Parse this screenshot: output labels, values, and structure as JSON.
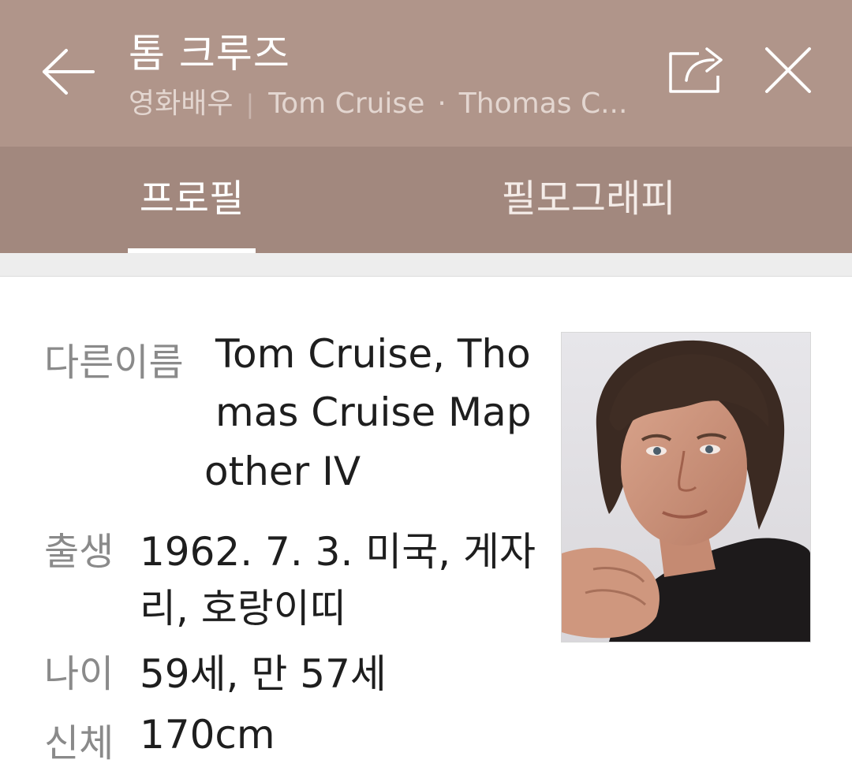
{
  "header": {
    "title": "톰 크루즈",
    "category": "영화배우",
    "separator": "|",
    "alt_name_1": "Tom Cruise",
    "dot": "·",
    "alt_name_2": "Thomas C...",
    "back_icon": "arrow-left-icon",
    "share_icon": "share-icon",
    "close_icon": "close-icon"
  },
  "tabs": [
    {
      "label": "프로필",
      "active": true
    },
    {
      "label": "필모그래피",
      "active": false
    }
  ],
  "profile": {
    "other_names": {
      "label": "다른이름",
      "lines": [
        "Tom Cruise, Tho",
        "mas Cruise Map",
        "other IV"
      ]
    },
    "birth": {
      "label": "출생",
      "lines": [
        "1962. 7. 3. 미국, 게자",
        "리, 호랑이띠"
      ]
    },
    "age": {
      "label": "나이",
      "value": "59세, 만 57세"
    },
    "body": {
      "label": "신체",
      "value": "170cm"
    }
  },
  "colors": {
    "header_bg": "#b0958a",
    "tabs_bg": "#a2887e",
    "label": "#8a8a8a",
    "value": "#1e1e1e"
  }
}
